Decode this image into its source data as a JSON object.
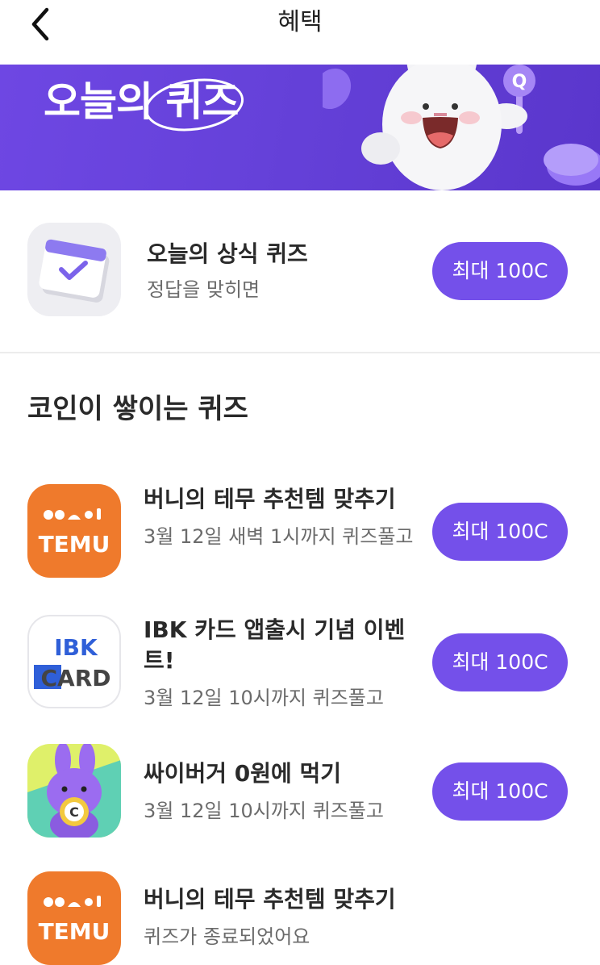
{
  "header": {
    "title": "혜택"
  },
  "banner": {
    "text_prefix": "오늘의 ",
    "text_highlight": "퀴즈"
  },
  "daily_quiz": {
    "title": "오늘의 상식 퀴즈",
    "subtitle": "정답을 맞히면",
    "reward": "최대 100C"
  },
  "section": {
    "title": "코인이 쌓이는 퀴즈"
  },
  "quizzes": [
    {
      "icon": "temu-logo",
      "title": "버니의 테무 추천템 맞추기",
      "subtitle": "3월 12일 새벽 1시까지 퀴즈풀고",
      "reward": "최대 100C"
    },
    {
      "icon": "ibk-card-logo",
      "title_line1": "IBK 카드 앱출시 기념 이벤",
      "title_line2": "트!",
      "subtitle": "3월 12일 10시까지 퀴즈풀고",
      "reward": "최대 100C"
    },
    {
      "icon": "cyber-bunny-coin",
      "title": "싸이버거 0원에 먹기",
      "subtitle": "3월 12일 10시까지 퀴즈풀고",
      "reward": "최대 100C"
    },
    {
      "icon": "temu-logo",
      "title": "버니의 테무 추천템 맞추기",
      "subtitle": "퀴즈가 종료되었어요"
    }
  ],
  "logos": {
    "temu": "TEMU",
    "ibk": "IBK",
    "card": "CARD",
    "coin": "C"
  },
  "colors": {
    "accent": "#7450ea",
    "banner": "#6541d9",
    "temu": "#ef7a2c",
    "ibk_blue": "#2f5fd8"
  }
}
